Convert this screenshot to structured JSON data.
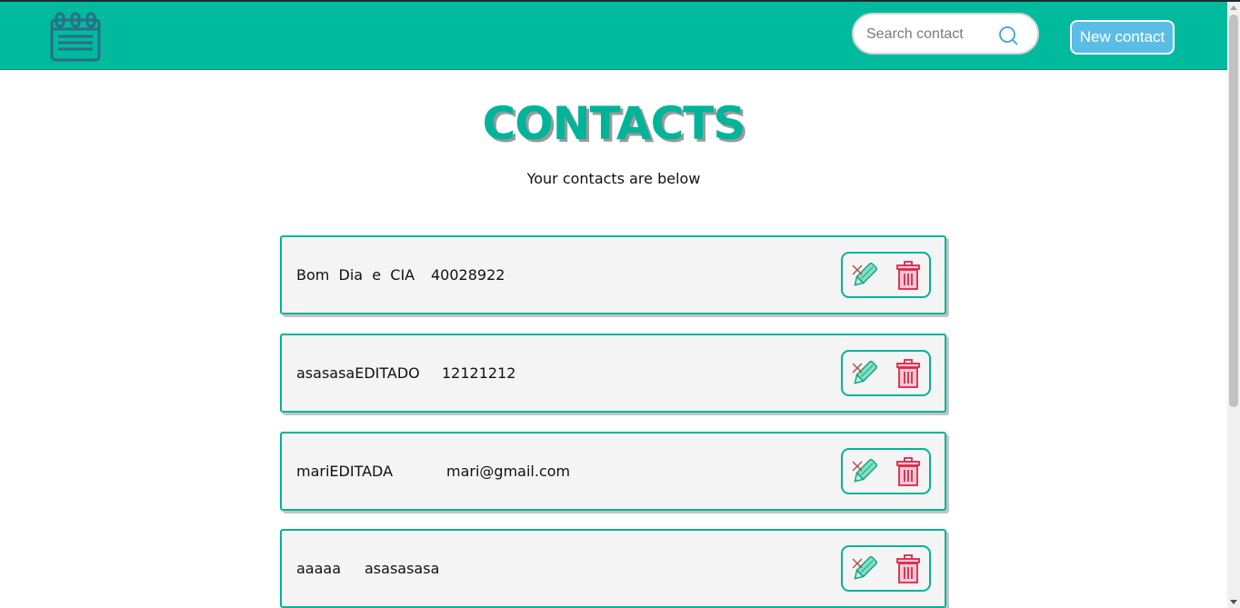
{
  "header": {
    "logo_icon": "calendar-notebook-icon",
    "search_placeholder": "Search contact",
    "search_icon": "search-icon",
    "new_contact_label": "New contact",
    "bg_color": "#00ba9e",
    "button_color": "#5bbde5"
  },
  "main": {
    "title": "CONTACTS",
    "subtitle": "Your contacts are below",
    "accent_color": "#00b49a"
  },
  "contacts": [
    {
      "name": "Bom  Dia  e  CIA",
      "info": "40028922",
      "edit_icon": "pencil-icon",
      "delete_icon": "trash-icon"
    },
    {
      "name": "asasasaEDITADO",
      "info": "12121212",
      "edit_icon": "pencil-icon",
      "delete_icon": "trash-icon"
    },
    {
      "name": "mariEDITADA",
      "info": "mari@gmail.com",
      "edit_icon": "pencil-icon",
      "delete_icon": "trash-icon"
    },
    {
      "name": "aaaaa",
      "info": "asasasasa",
      "edit_icon": "pencil-icon",
      "delete_icon": "trash-icon"
    }
  ]
}
